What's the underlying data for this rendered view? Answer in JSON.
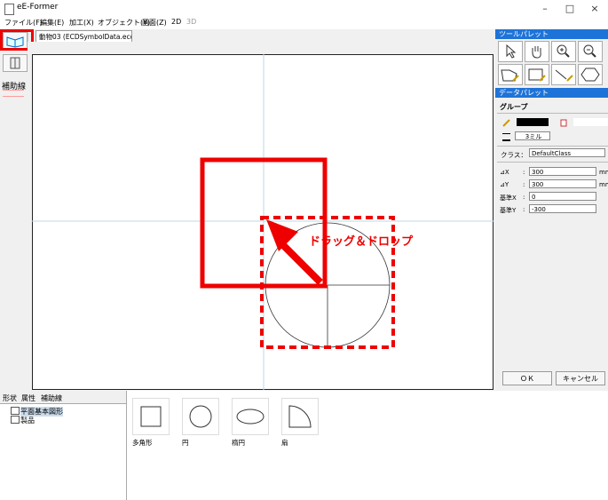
{
  "window": {
    "title": "eE-Former",
    "minimize": "–",
    "maximize": "□",
    "close": "×"
  },
  "menu": [
    "ファイル(F)",
    "編集(E)",
    "加工(X)",
    "オブジェクト(Y)",
    "画面(Z)",
    "2D",
    "3D"
  ],
  "left_toolbar": {
    "hojo_label": "補助線"
  },
  "document_tab": {
    "label": "動物03 (ECDSymbolData.ecd)"
  },
  "tool_palette": {
    "header": "ツールパレット"
  },
  "data_palette": {
    "header": "データパレット",
    "group_label": "グループ",
    "line_width": "3ミル",
    "class_label": "クラス：",
    "class_value": "DefaultClass",
    "fields": [
      {
        "label": "⊿X",
        "value": "300",
        "unit": "mm"
      },
      {
        "label": "⊿Y",
        "value": "300",
        "unit": "mm"
      },
      {
        "label": "基準X",
        "value": "0",
        "unit": ""
      },
      {
        "label": "基準Y",
        "value": "-300",
        "unit": ""
      }
    ],
    "ok_label": "ＯＫ",
    "cancel_label": "キャンセル"
  },
  "bottom_tabs": [
    "形状",
    "属性",
    "補助線"
  ],
  "tree": {
    "item1": "平面基本図形",
    "item2": "製品"
  },
  "shapes": [
    {
      "label": "多角形",
      "icon": "square-shape-icon"
    },
    {
      "label": "円",
      "icon": "circle-shape-icon"
    },
    {
      "label": "楕円",
      "icon": "ellipse-shape-icon"
    },
    {
      "label": "扇",
      "icon": "sector-shape-icon"
    }
  ],
  "annotation": {
    "text": "ドラッグ＆ドロップ",
    "color": "#e00000"
  },
  "colors": {
    "palette_header": "#1e73d8",
    "highlight": "#e00000"
  }
}
